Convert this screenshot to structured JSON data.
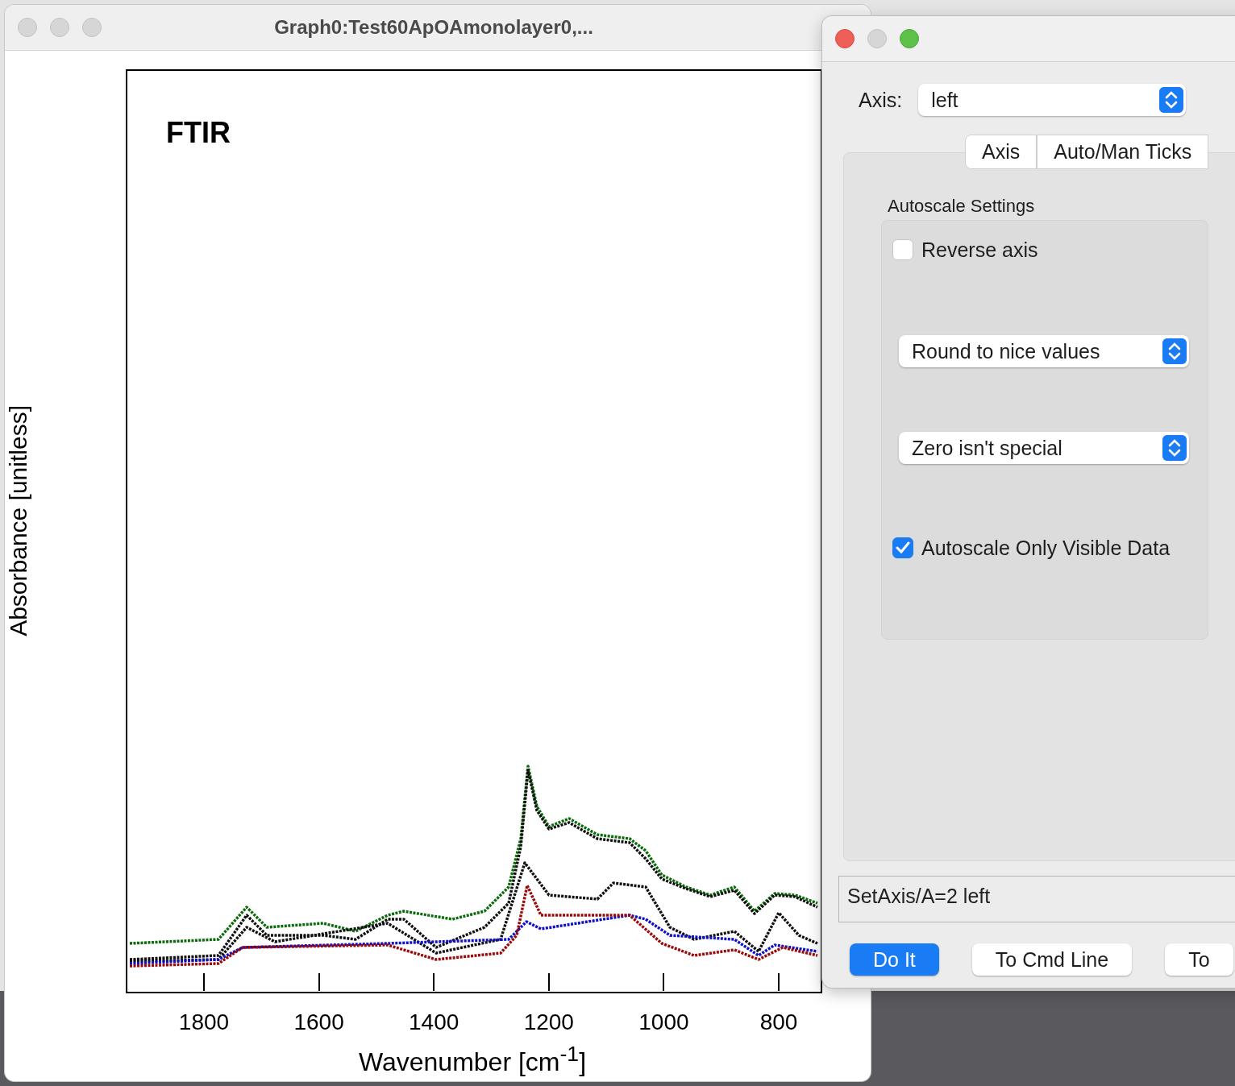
{
  "graph_window": {
    "title": "Graph0:Test60ApOAmonolayer0,...",
    "plot": {
      "title": "FTIR",
      "ylabel": "Absorbance [unitless]",
      "xlabel": "Wavenumber [cm$^{-1}$]",
      "xtick_labels": [
        "1800",
        "1600",
        "1400",
        "1200",
        "1000",
        "800"
      ]
    }
  },
  "dialog": {
    "axis_label": "Axis:",
    "axis_select": "left",
    "tabs": [
      {
        "label": "Axis",
        "selected": false
      },
      {
        "label": "Auto/Man Ticks",
        "selected": false
      }
    ],
    "group_title": "Autoscale Settings",
    "controls": [
      {
        "kind": "checkbox",
        "label": "Reverse axis",
        "checked": false
      },
      {
        "kind": "select",
        "value": "Round to nice values"
      },
      {
        "kind": "select",
        "value": "Zero isn't special"
      },
      {
        "kind": "checkbox",
        "label": "Autoscale Only Visible Data",
        "checked": true
      }
    ],
    "command": "SetAxis/A=2 left",
    "buttons": [
      {
        "label": "Do It",
        "default": true
      },
      {
        "label": "To Cmd Line",
        "default": false
      },
      {
        "label": "To",
        "default": false
      }
    ]
  }
}
